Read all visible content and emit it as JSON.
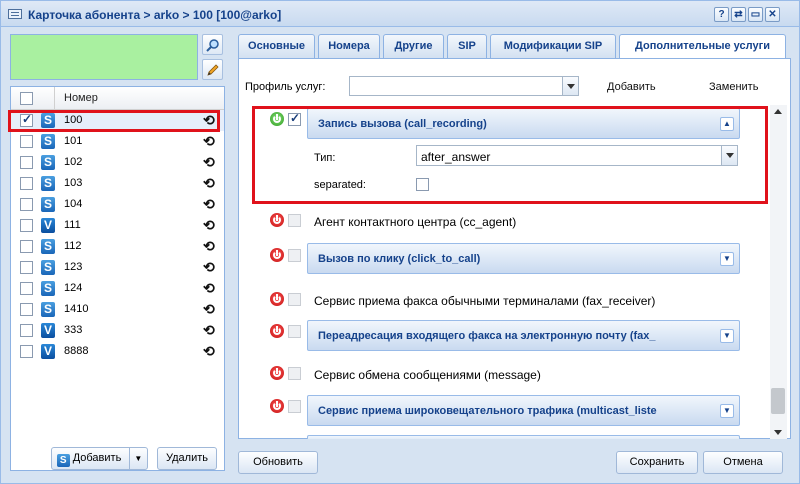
{
  "window": {
    "title": "Карточка абонента > arko > 100 [100@arko]",
    "controls": [
      "?",
      "⇄",
      "▭",
      "✕"
    ]
  },
  "left": {
    "tools": [
      "search-icon",
      "pencil-icon"
    ],
    "list_header": "Номер",
    "rows": [
      {
        "type": "S",
        "number": "100",
        "checked": true
      },
      {
        "type": "S",
        "number": "101",
        "checked": false
      },
      {
        "type": "S",
        "number": "102",
        "checked": false
      },
      {
        "type": "S",
        "number": "103",
        "checked": false
      },
      {
        "type": "S",
        "number": "104",
        "checked": false
      },
      {
        "type": "V",
        "number": "111",
        "checked": false
      },
      {
        "type": "S",
        "number": "112",
        "checked": false
      },
      {
        "type": "S",
        "number": "123",
        "checked": false
      },
      {
        "type": "S",
        "number": "124",
        "checked": false
      },
      {
        "type": "S",
        "number": "1410",
        "checked": false
      },
      {
        "type": "V",
        "number": "333",
        "checked": false
      },
      {
        "type": "V",
        "number": "8888",
        "checked": false
      }
    ],
    "add_label": "Добавить",
    "delete_label": "Удалить"
  },
  "tabs": [
    "Основные",
    "Номера",
    "Другие",
    "SIP",
    "Модификации SIP",
    "Дополнительные услуги"
  ],
  "active_tab": "Дополнительные услуги",
  "profile": {
    "label": "Профиль услуг:",
    "value": "",
    "add_label": "Добавить",
    "replace_label": "Заменить"
  },
  "services": [
    {
      "title": "Запись вызова (call_recording)",
      "kind": "panel",
      "enabled": true,
      "checked": true,
      "expanded": true,
      "fields": {
        "type_label": "Тип:",
        "type_value": "after_answer",
        "separated_label": "separated:",
        "separated": false
      }
    },
    {
      "title": "Агент контактного центра (cc_agent)",
      "kind": "plain",
      "enabled": false,
      "checked": false
    },
    {
      "title": "Вызов по клику (click_to_call)",
      "kind": "panel",
      "enabled": false,
      "checked": false
    },
    {
      "title": "Сервис приема факса обычными терминалами (fax_receiver)",
      "kind": "plain",
      "enabled": false,
      "checked": false
    },
    {
      "title": "Переадресация входящего факса на электронную почту (fax_",
      "kind": "panel",
      "enabled": false,
      "checked": false
    },
    {
      "title": "Сервис обмена сообщениями (message)",
      "kind": "plain",
      "enabled": false,
      "checked": false
    },
    {
      "title": "Сервис приема широковещательного трафика (multicast_liste",
      "kind": "panel",
      "enabled": false,
      "checked": false
    }
  ],
  "footer": {
    "refresh_label": "Обновить",
    "save_label": "Сохранить",
    "cancel_label": "Отмена"
  }
}
